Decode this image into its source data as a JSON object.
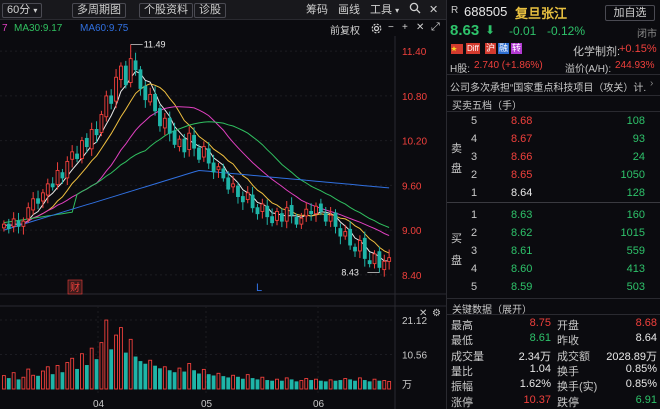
{
  "toolbar": {
    "period": "60分",
    "period_menu": "多周期图",
    "stock_info": "个股资料",
    "diagnose": "诊股",
    "tool_draw": "筹码",
    "tool_line": "画线",
    "tool_tools": "工具",
    "add_watch": "加自选"
  },
  "ma_line": {
    "ma20_partial": "7",
    "ma30": "MA30:9.17",
    "ma60": "MA60:9.75",
    "adjust": "前复权"
  },
  "stock": {
    "tag": "R",
    "code": "688505",
    "name": "复旦张江",
    "price": "8.63",
    "change": "-0.01",
    "change_pct": "-0.12%",
    "status": "闭市",
    "badges": [
      "Diff",
      "沪",
      "融",
      "转"
    ],
    "badge_colors": [
      "#d23a2e",
      "#d23a2e",
      "#2e6fd2",
      "#b23ad2"
    ],
    "chem_label": "化学制剂:",
    "chem_value": "+0.15%",
    "h_label": "H股:",
    "h_value": "2.740 (+1.86%)",
    "premium_label": "溢价(A/H):",
    "premium_value": "244.93%",
    "news": "公司多次承担“国家重点科技项目（攻关）计..."
  },
  "order_book": {
    "title": "买卖五档（手）",
    "sell_label": [
      "卖",
      "盘"
    ],
    "buy_label": [
      "买",
      "盘"
    ],
    "sell": [
      {
        "level": "5",
        "price": "8.68",
        "vol": "108"
      },
      {
        "level": "4",
        "price": "8.67",
        "vol": "93"
      },
      {
        "level": "3",
        "price": "8.66",
        "vol": "24"
      },
      {
        "level": "2",
        "price": "8.65",
        "vol": "1050"
      },
      {
        "level": "1",
        "price": "8.64",
        "vol": "128"
      }
    ],
    "buy": [
      {
        "level": "1",
        "price": "8.63",
        "vol": "160"
      },
      {
        "level": "2",
        "price": "8.62",
        "vol": "1015"
      },
      {
        "level": "3",
        "price": "8.61",
        "vol": "559"
      },
      {
        "level": "4",
        "price": "8.60",
        "vol": "413"
      },
      {
        "level": "5",
        "price": "8.59",
        "vol": "503"
      }
    ]
  },
  "key_data": {
    "title": "关键数据（展开）",
    "rows": [
      {
        "l1": "最高",
        "v1": "8.75",
        "c1": "red",
        "l2": "开盘",
        "v2": "8.68",
        "c2": "red"
      },
      {
        "l1": "最低",
        "v1": "8.61",
        "c1": "green",
        "l2": "昨收",
        "v2": "8.64",
        "c2": "white"
      },
      {
        "l1": "成交量",
        "v1": "2.34万",
        "c1": "white",
        "l2": "成交额",
        "v2": "2028.89万",
        "c2": "white"
      },
      {
        "l1": "量比",
        "v1": "1.04",
        "c1": "white",
        "l2": "换手",
        "v2": "0.85%",
        "c2": "white"
      },
      {
        "l1": "振幅",
        "v1": "1.62%",
        "c1": "white",
        "l2": "换手(实)",
        "v2": "0.85%",
        "c2": "white"
      },
      {
        "l1": "涨停",
        "v1": "10.37",
        "c1": "red",
        "l2": "跌停",
        "v2": "6.91",
        "c2": "green"
      }
    ]
  },
  "chart_data": {
    "type": "candlestick",
    "price_axis": [
      "11.40",
      "10.80",
      "10.20",
      "9.60",
      "9.00",
      "8.40"
    ],
    "price_range": [
      8.25,
      11.55
    ],
    "volume_axis": [
      "21.12",
      "10.56"
    ],
    "volume_unit": "万",
    "volume_max": 21.12,
    "x_labels": [
      "04",
      "05",
      "06"
    ],
    "high_mark": "11.49",
    "low_mark": "8.43",
    "markers": [
      "财",
      "L"
    ],
    "ma_colors": {
      "ma5": "#e8e8e8",
      "ma10": "#f0c040",
      "ma20": "#e040c0",
      "ma30": "#30c060",
      "ma60": "#3070e0"
    },
    "up_color": "#f0403c",
    "down_color": "#1fb5a8",
    "closes": [
      9.08,
      9.02,
      9.15,
      9.05,
      9.12,
      9.3,
      9.42,
      9.36,
      9.5,
      9.62,
      9.58,
      9.8,
      9.7,
      9.92,
      10.05,
      9.96,
      10.2,
      10.12,
      10.35,
      10.28,
      10.55,
      10.8,
      10.7,
      11.05,
      11.2,
      10.95,
      11.3,
      11.15,
      10.9,
      10.75,
      10.82,
      10.6,
      10.4,
      10.5,
      10.3,
      10.15,
      10.22,
      10.05,
      10.3,
      10.1,
      9.95,
      10.12,
      9.9,
      9.78,
      9.85,
      9.7,
      9.55,
      9.62,
      9.45,
      9.38,
      9.5,
      9.3,
      9.22,
      9.35,
      9.18,
      9.1,
      9.25,
      9.12,
      9.3,
      9.2,
      9.08,
      9.16,
      9.28,
      9.22,
      9.32,
      9.25,
      9.12,
      9.2,
      9.05,
      8.92,
      8.98,
      8.8,
      8.72,
      8.86,
      8.62,
      8.55,
      8.68,
      8.5,
      8.58,
      8.63
    ],
    "volumes": [
      4.1,
      3.2,
      5.0,
      2.8,
      3.6,
      6.1,
      4.2,
      3.9,
      5.5,
      6.8,
      4.4,
      7.2,
      5.0,
      8.1,
      9.4,
      6.0,
      10.8,
      7.2,
      12.5,
      9.0,
      14.2,
      21.1,
      12.0,
      16.5,
      18.8,
      11.0,
      15.2,
      9.8,
      8.4,
      7.6,
      8.8,
      7.0,
      6.2,
      6.8,
      5.6,
      5.0,
      6.4,
      5.2,
      7.8,
      5.6,
      4.6,
      6.0,
      4.4,
      4.0,
      4.8,
      3.8,
      3.4,
      4.2,
      3.6,
      3.0,
      4.4,
      3.2,
      2.8,
      3.6,
      2.6,
      2.4,
      3.0,
      2.4,
      3.4,
      2.8,
      2.2,
      2.6,
      3.2,
      2.6,
      3.0,
      2.4,
      2.2,
      2.8,
      2.4,
      2.6,
      3.2,
      2.8,
      2.4,
      3.4,
      2.6,
      2.2,
      3.0,
      2.4,
      2.6,
      2.3
    ]
  }
}
